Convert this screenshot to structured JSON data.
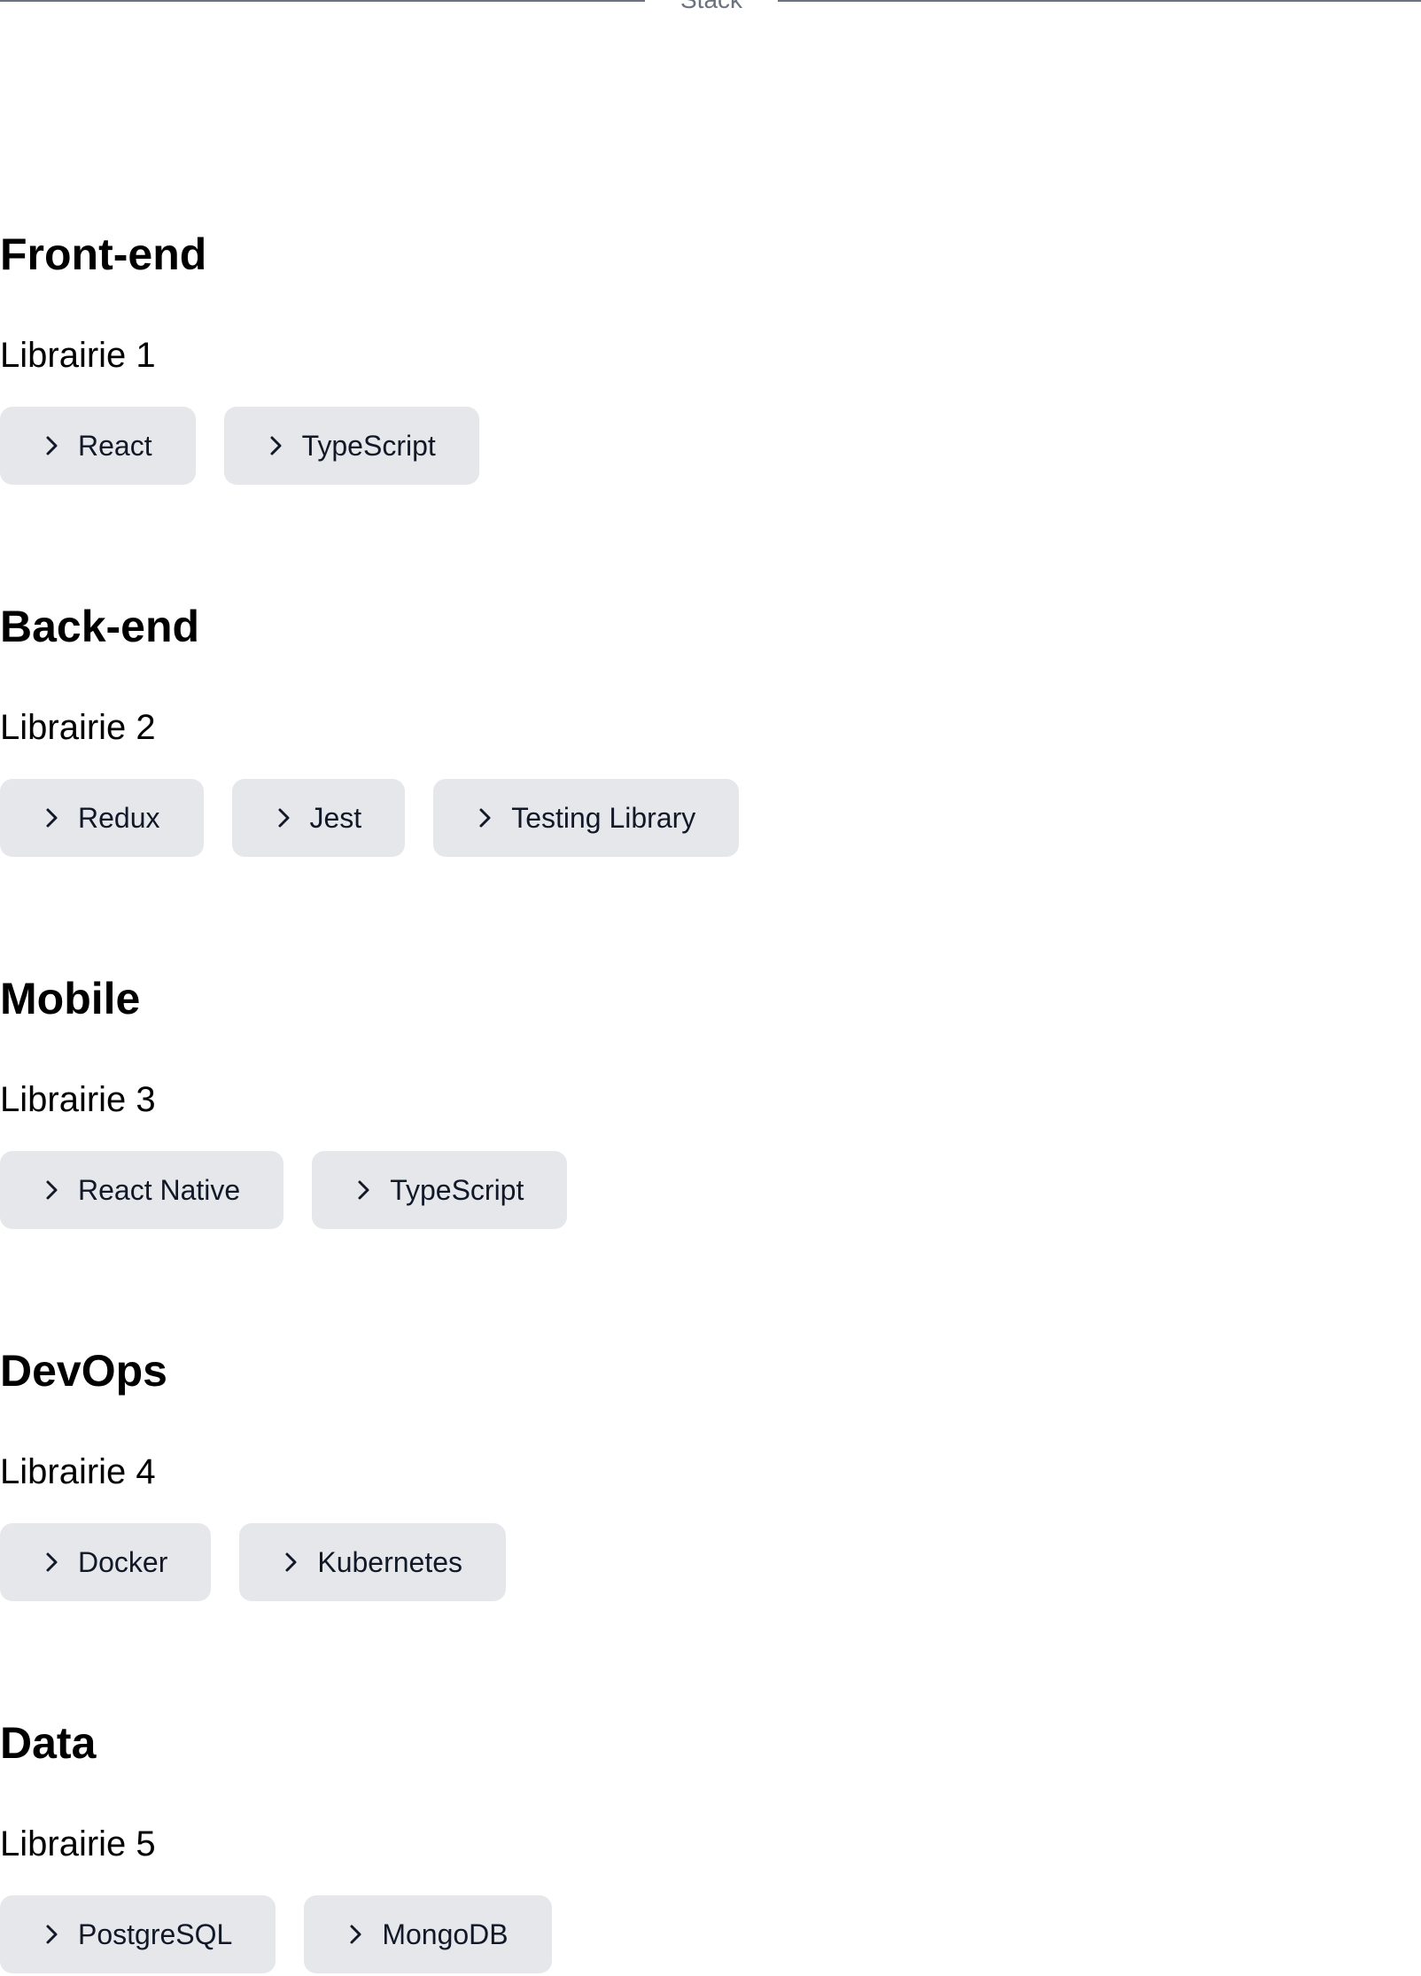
{
  "divider": {
    "label": "Stack"
  },
  "sections": [
    {
      "title": "Front-end",
      "subtitle": "Librairie 1",
      "chips": [
        "React",
        "TypeScript"
      ]
    },
    {
      "title": "Back-end",
      "subtitle": "Librairie 2",
      "chips": [
        "Redux",
        "Jest",
        "Testing Library"
      ]
    },
    {
      "title": "Mobile",
      "subtitle": "Librairie 3",
      "chips": [
        "React Native",
        "TypeScript"
      ]
    },
    {
      "title": "DevOps",
      "subtitle": "Librairie 4",
      "chips": [
        "Docker",
        "Kubernetes"
      ]
    },
    {
      "title": "Data",
      "subtitle": "Librairie 5",
      "chips": [
        "PostgreSQL",
        "MongoDB"
      ]
    }
  ],
  "colors": {
    "chip_background": "#e5e7eb",
    "divider": "#6b7280",
    "text": "#000000"
  },
  "icons": {
    "chip": "chevron-right-icon"
  }
}
